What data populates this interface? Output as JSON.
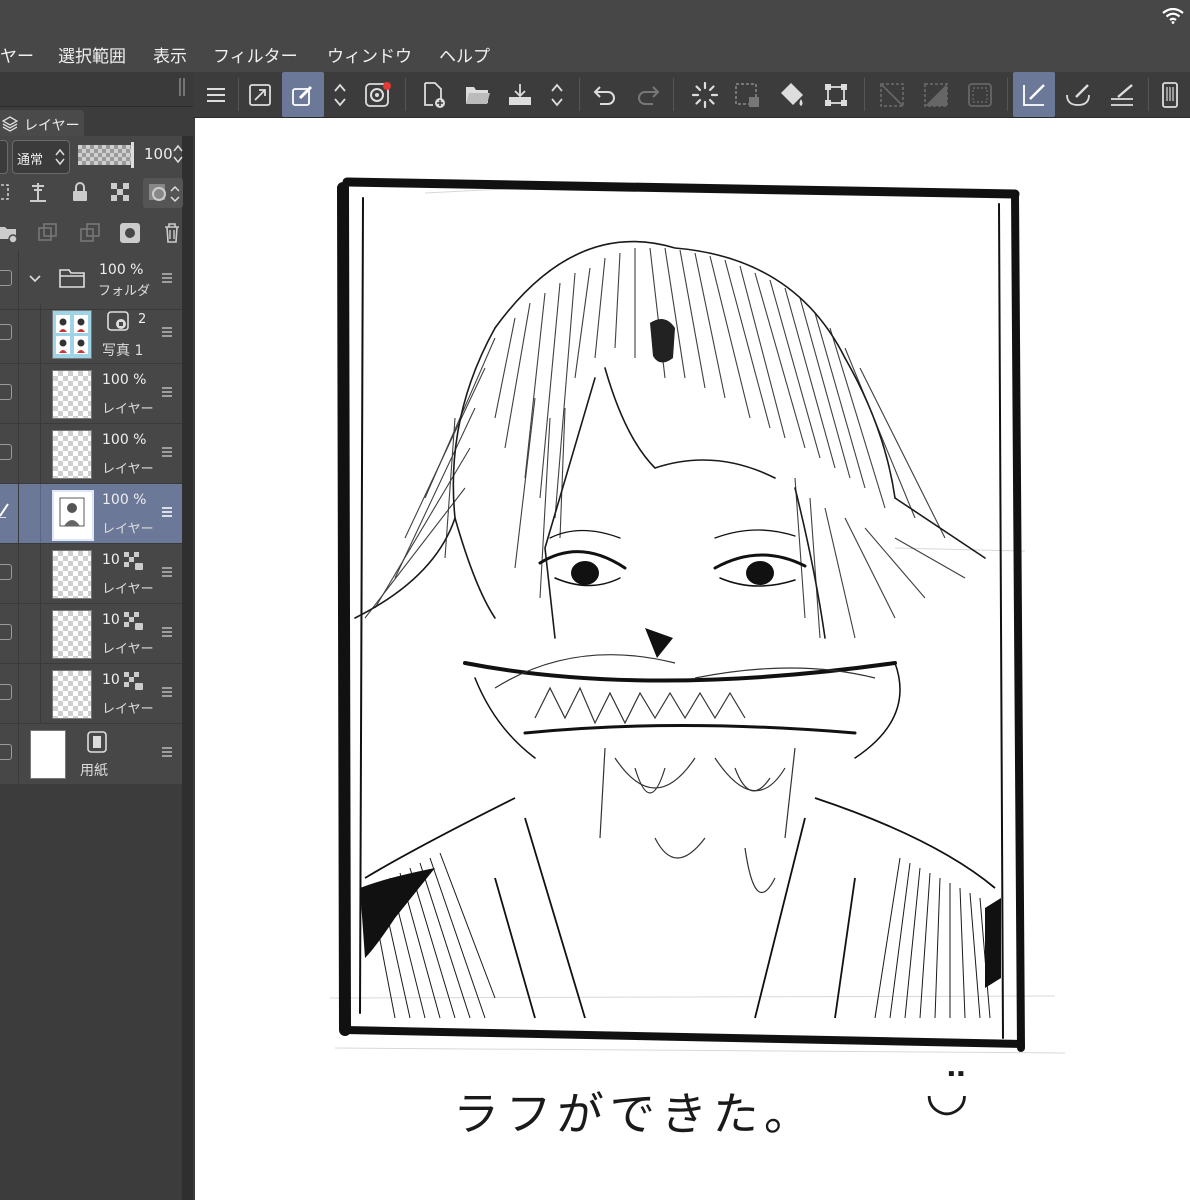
{
  "menu": {
    "items": [
      "ヤー",
      "選択範囲",
      "表示",
      "フィルター",
      "ウィンドウ",
      "ヘルプ"
    ]
  },
  "layer_panel": {
    "tab_label": "レイヤー",
    "blend_mode": "通常",
    "opacity_value": "100",
    "layers": [
      {
        "opacity": "100 %",
        "name": "フォルダ",
        "kind": "folder",
        "selected": false
      },
      {
        "opacity": "2",
        "name": "写真 1",
        "kind": "image",
        "selected": false
      },
      {
        "opacity": "100 %",
        "name": "レイヤー",
        "kind": "raster",
        "selected": false
      },
      {
        "opacity": "100 %",
        "name": "レイヤー",
        "kind": "raster",
        "selected": false
      },
      {
        "opacity": "100 %",
        "name": "レイヤー",
        "kind": "raster",
        "selected": true
      },
      {
        "opacity": "10",
        "name": "レイヤー",
        "kind": "raster-ref",
        "selected": false
      },
      {
        "opacity": "10",
        "name": "レイヤー",
        "kind": "raster-ref",
        "selected": false
      },
      {
        "opacity": "10",
        "name": "レイヤー",
        "kind": "raster-ref",
        "selected": false
      },
      {
        "opacity": "",
        "name": "用紙",
        "kind": "paper",
        "selected": false
      }
    ]
  },
  "toolbar": {
    "icons": [
      "menu-icon",
      "resize-icon",
      "pen-edit-icon",
      "up-down-icon",
      "color-icon",
      "new-file-icon",
      "open-folder-icon",
      "save-icon",
      "up-down-icon",
      "undo-icon",
      "redo-icon",
      "spinner-icon",
      "select-dotted-icon",
      "fill-bucket-icon",
      "transform-icon",
      "deselect-icon",
      "invert-icon",
      "border-icon",
      "ruler-snap-icon",
      "brush-icon",
      "ruler-icon",
      "device-icon"
    ],
    "active": [
      "pen-edit-icon",
      "ruler-snap-icon"
    ]
  },
  "canvas": {
    "caption": "ラフができた。",
    "smiley": "◡̈"
  },
  "colors": {
    "accent": "#6b7898",
    "background": "#3c3c3c",
    "canvas": "#ffffff",
    "record_dot": "#e53935"
  }
}
